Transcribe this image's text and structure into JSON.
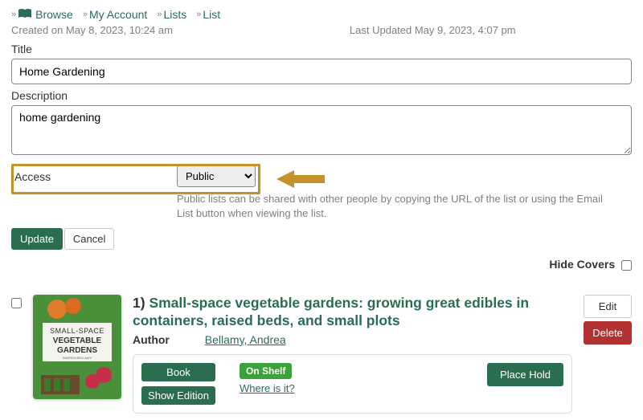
{
  "breadcrumb": {
    "browse": "Browse",
    "my_account": "My Account",
    "lists": "Lists",
    "list": "List"
  },
  "meta": {
    "created": "Created on May 8, 2023, 10:24 am",
    "updated": "Last Updated May 9, 2023, 4:07 pm"
  },
  "fields": {
    "title_label": "Title",
    "title_value": "Home Gardening",
    "desc_label": "Description",
    "desc_value": "home gardening",
    "access_label": "Access",
    "access_value": "Public",
    "access_help": "Public lists can be shared with other people by copying the URL of the list or using the Email List button when viewing the list."
  },
  "buttons": {
    "update": "Update",
    "cancel": "Cancel",
    "edit": "Edit",
    "delete": "Delete",
    "book": "Book",
    "show_edition": "Show Edition",
    "place_hold": "Place Hold"
  },
  "hide_covers_label": "Hide Covers",
  "item": {
    "num": "1)",
    "title": "Small-space vegetable gardens: growing great edibles in containers, raised beds, and small plots",
    "author_label": "Author",
    "author": "Bellamy, Andrea",
    "status": "On Shelf",
    "where": "Where is it?",
    "cover": {
      "line1": "SMALL-SPACE",
      "line2": "VEGETABLE",
      "line3": "GARDENS",
      "byline": "ANDREA BELLAMY"
    }
  }
}
